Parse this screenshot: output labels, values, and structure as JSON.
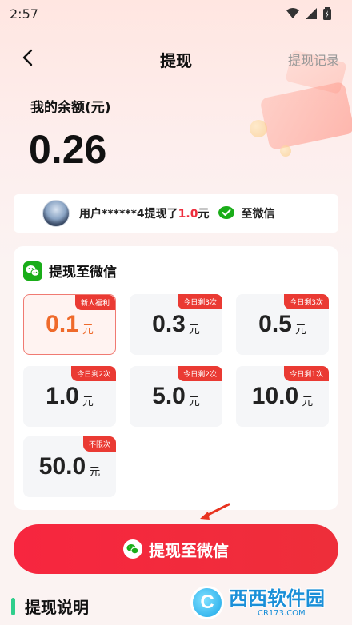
{
  "status_bar": {
    "time": "2:57"
  },
  "nav": {
    "title": "提现",
    "history": "提现记录"
  },
  "balance": {
    "label": "我的余额(元)",
    "value": "0.26"
  },
  "ticker": {
    "prefix": "用户******4提现了",
    "amount": "1.0",
    "suffix": "元",
    "destination": "至微信"
  },
  "panel": {
    "title": "提现至微信",
    "unit": "元",
    "options": [
      {
        "amount": "0.1",
        "badge": "新人福利",
        "selected": true
      },
      {
        "amount": "0.3",
        "badge": "今日剩3次",
        "selected": false
      },
      {
        "amount": "0.5",
        "badge": "今日剩3次",
        "selected": false
      },
      {
        "amount": "1.0",
        "badge": "今日剩2次",
        "selected": false
      },
      {
        "amount": "5.0",
        "badge": "今日剩2次",
        "selected": false
      },
      {
        "amount": "10.0",
        "badge": "今日剩1次",
        "selected": false
      },
      {
        "amount": "50.0",
        "badge": "不限次",
        "selected": false
      }
    ]
  },
  "button": {
    "label": "提现至微信"
  },
  "description": {
    "title": "提现说明"
  },
  "watermark": {
    "name": "西西软件园",
    "url": "CR173.COM"
  },
  "colors": {
    "primary": "#EE2E3A",
    "selected_text": "#EF6A2B",
    "wechat_green": "#1AAD19",
    "desc_bar": "#2FCE8C"
  }
}
